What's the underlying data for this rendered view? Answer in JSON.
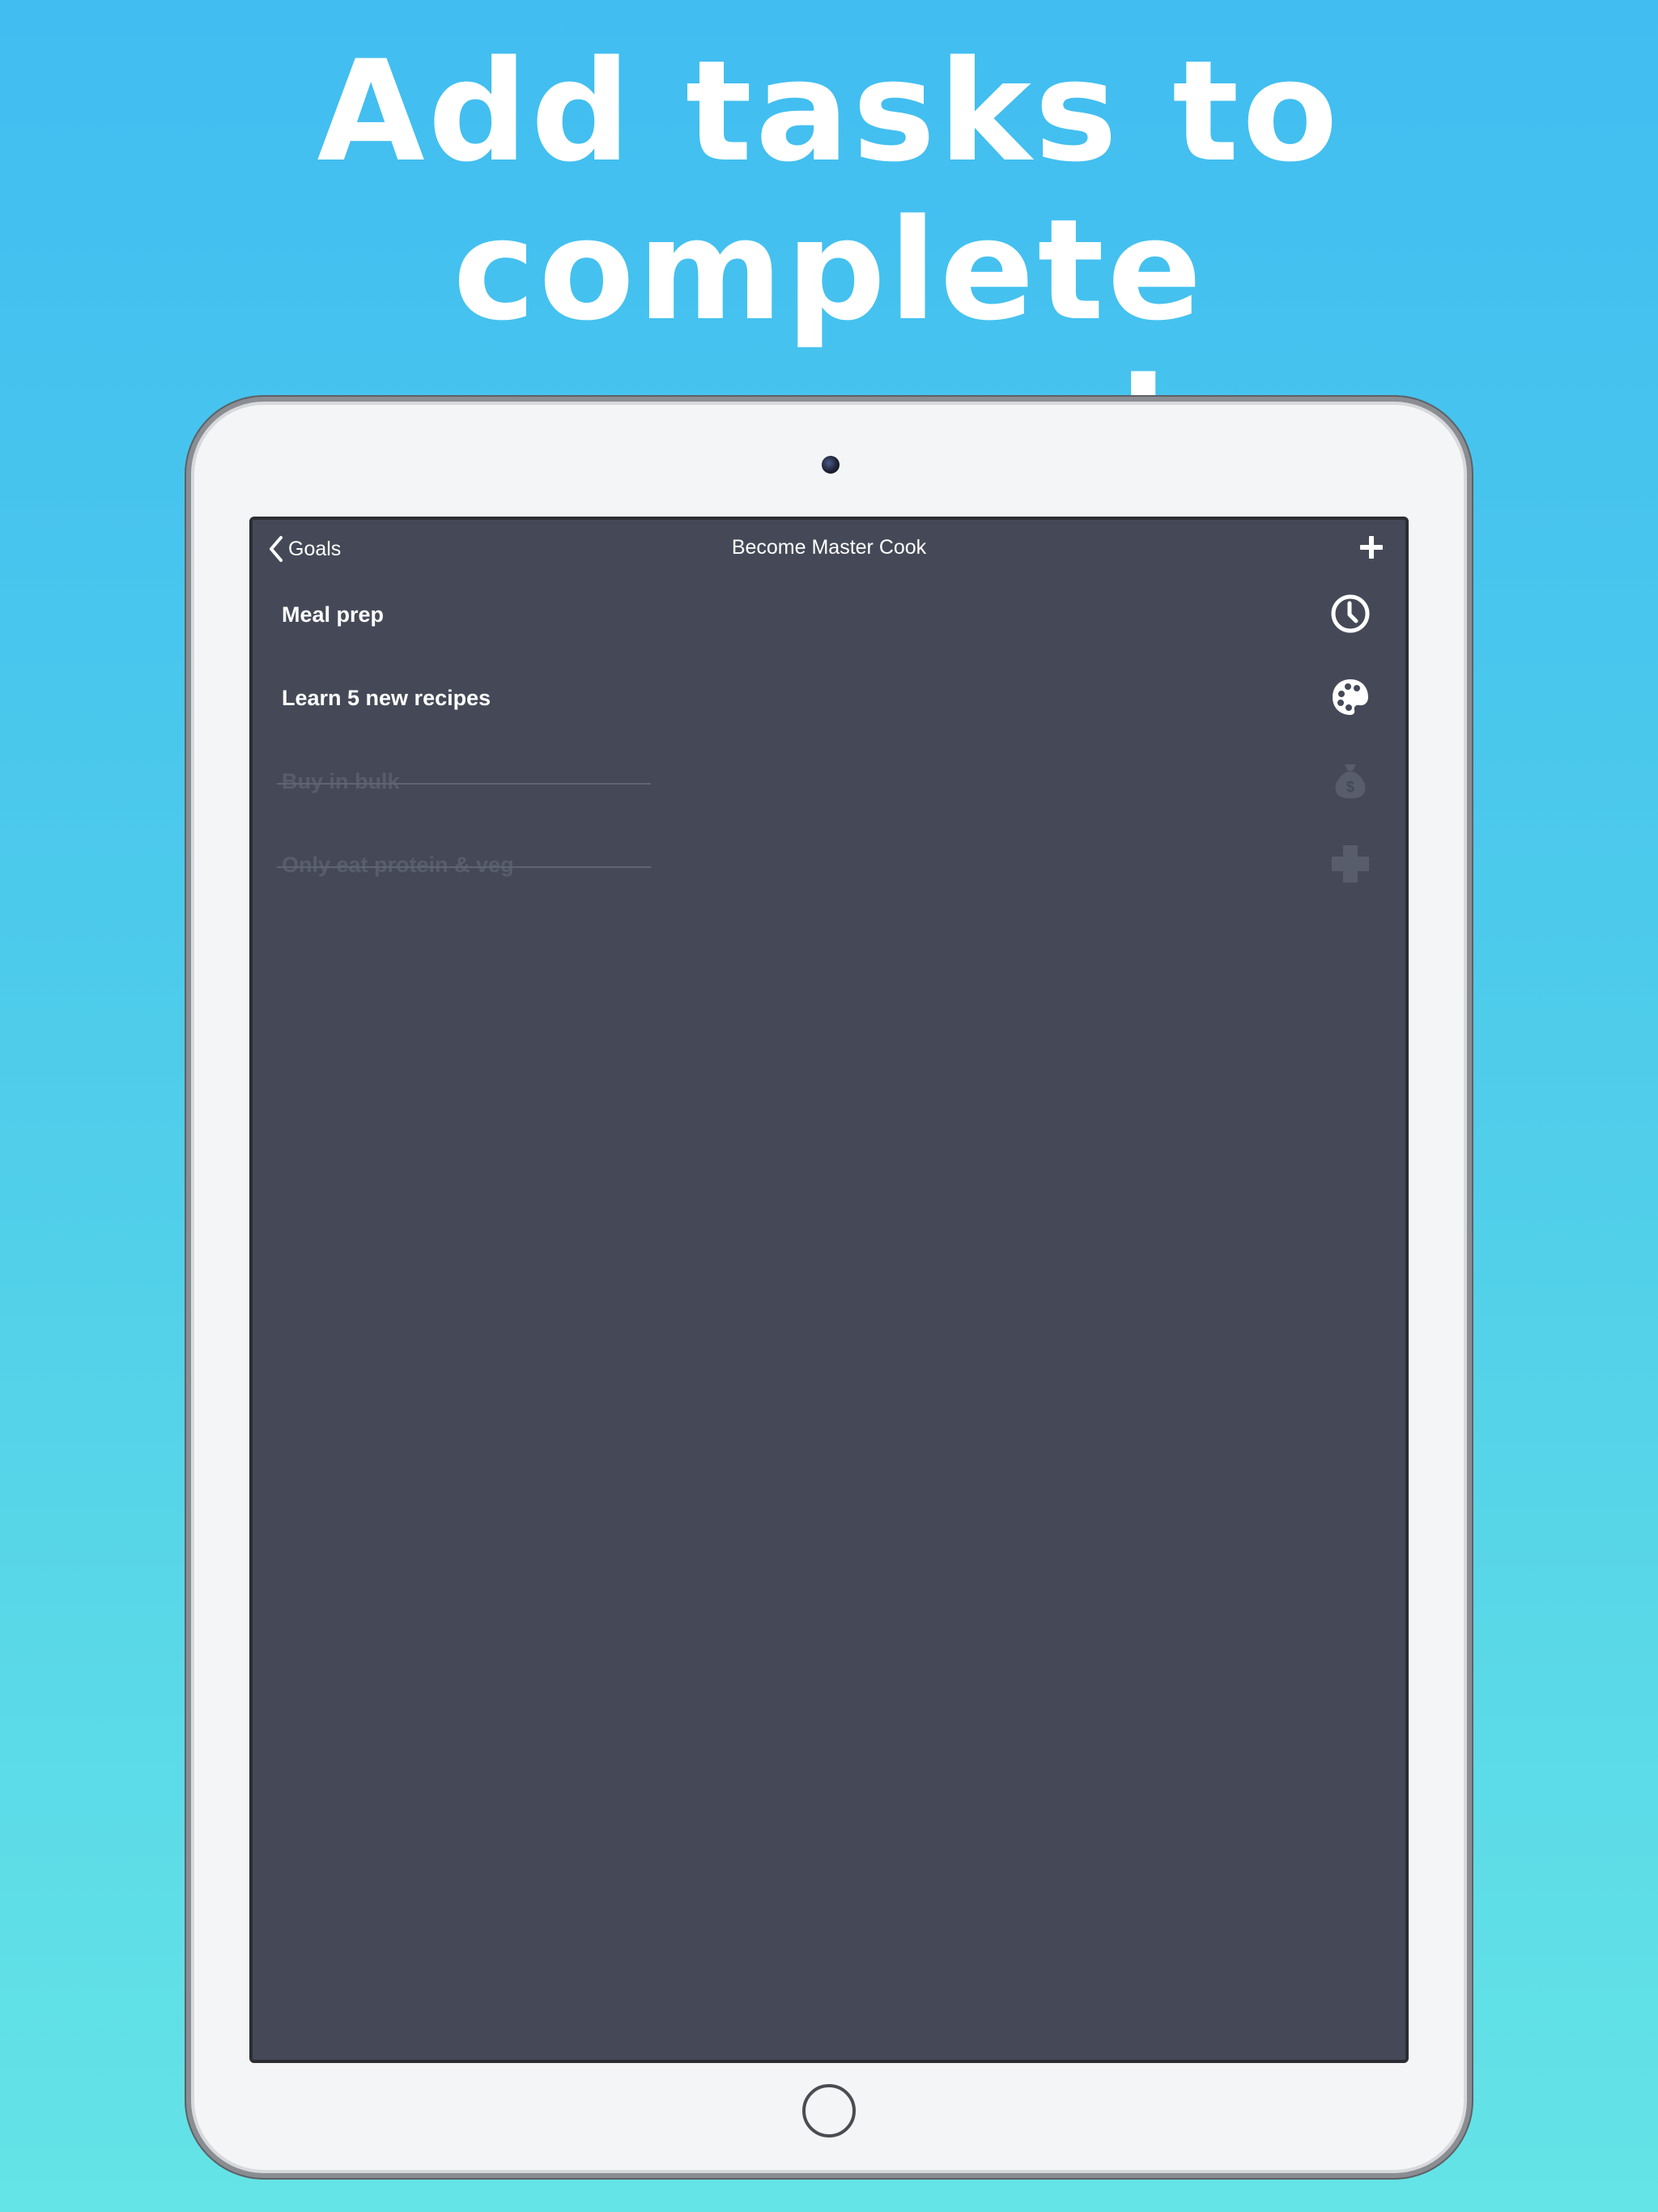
{
  "headline": {
    "line1": "Add tasks to complete",
    "line2": "your goals"
  },
  "nav": {
    "back_label": "Goals",
    "title": "Become Master Cook",
    "add_icon": "plus-icon"
  },
  "tasks": [
    {
      "label": "Meal prep",
      "icon": "clock-icon",
      "completed": false
    },
    {
      "label": "Learn 5 new recipes",
      "icon": "palette-icon",
      "completed": false
    },
    {
      "label": "Buy in bulk",
      "icon": "money-bag-icon",
      "completed": true
    },
    {
      "label": "Only eat protein & veg",
      "icon": "medical-cross-icon",
      "completed": true
    }
  ],
  "colors": {
    "background_top": "#41bdf1",
    "background_bottom": "#64e4e6",
    "screen": "#454957",
    "completed_text": "#585d6c"
  }
}
